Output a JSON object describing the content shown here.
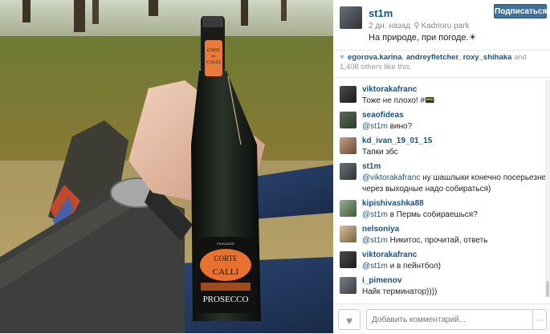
{
  "post": {
    "username": "st1m",
    "time_ago": "2 дн. назад",
    "location": "Kadrioru park",
    "caption": "На природе, при погоде.☀",
    "follow_label": "Подписаться"
  },
  "likes": {
    "users": [
      "egorova.karina",
      "andreyfletcher",
      "roxy_shihaka"
    ],
    "separator": ", ",
    "and_text": " and ",
    "others_count": "1,408",
    "others_text": " others like this."
  },
  "photo": {
    "bottle_brand_top": "CORTE",
    "bottle_brand_mid": "dei",
    "bottle_brand_bottom": "CALLI",
    "bottle_small": "FRIZZANTE",
    "bottle_product": "PROSECCO"
  },
  "comments": [
    {
      "user": "viktorakafranc",
      "mention": "",
      "text": "Тоже не плохо! #📟"
    },
    {
      "user": "seaofideas",
      "mention": "@st1m",
      "text": " вино?"
    },
    {
      "user": "kd_ivan_19_01_15",
      "mention": "",
      "text": "Тапки збс"
    },
    {
      "user": "st1m",
      "mention": "@viktorakafranc",
      "text": " ну шашлыки конечно посерьезнее)",
      "text2": "через выходные надо собираться)"
    },
    {
      "user": "kipishivashka88",
      "mention": "@st1m",
      "text": " в Пермь собираешься?"
    },
    {
      "user": "nelsoniya",
      "mention": "@st1m",
      "text": " Никитос, прочитай, ответь"
    },
    {
      "user": "viktorakafranc",
      "mention": "@st1m",
      "text": " и в пейнтбол)"
    },
    {
      "user": "i_pimenov",
      "mention": "",
      "text": "Найк терминатор))))"
    }
  ],
  "footer": {
    "comment_placeholder": "Добавить комментарий...",
    "more_label": "···"
  },
  "colors": {
    "link": "#125688",
    "follow_button": "#3f729b"
  }
}
